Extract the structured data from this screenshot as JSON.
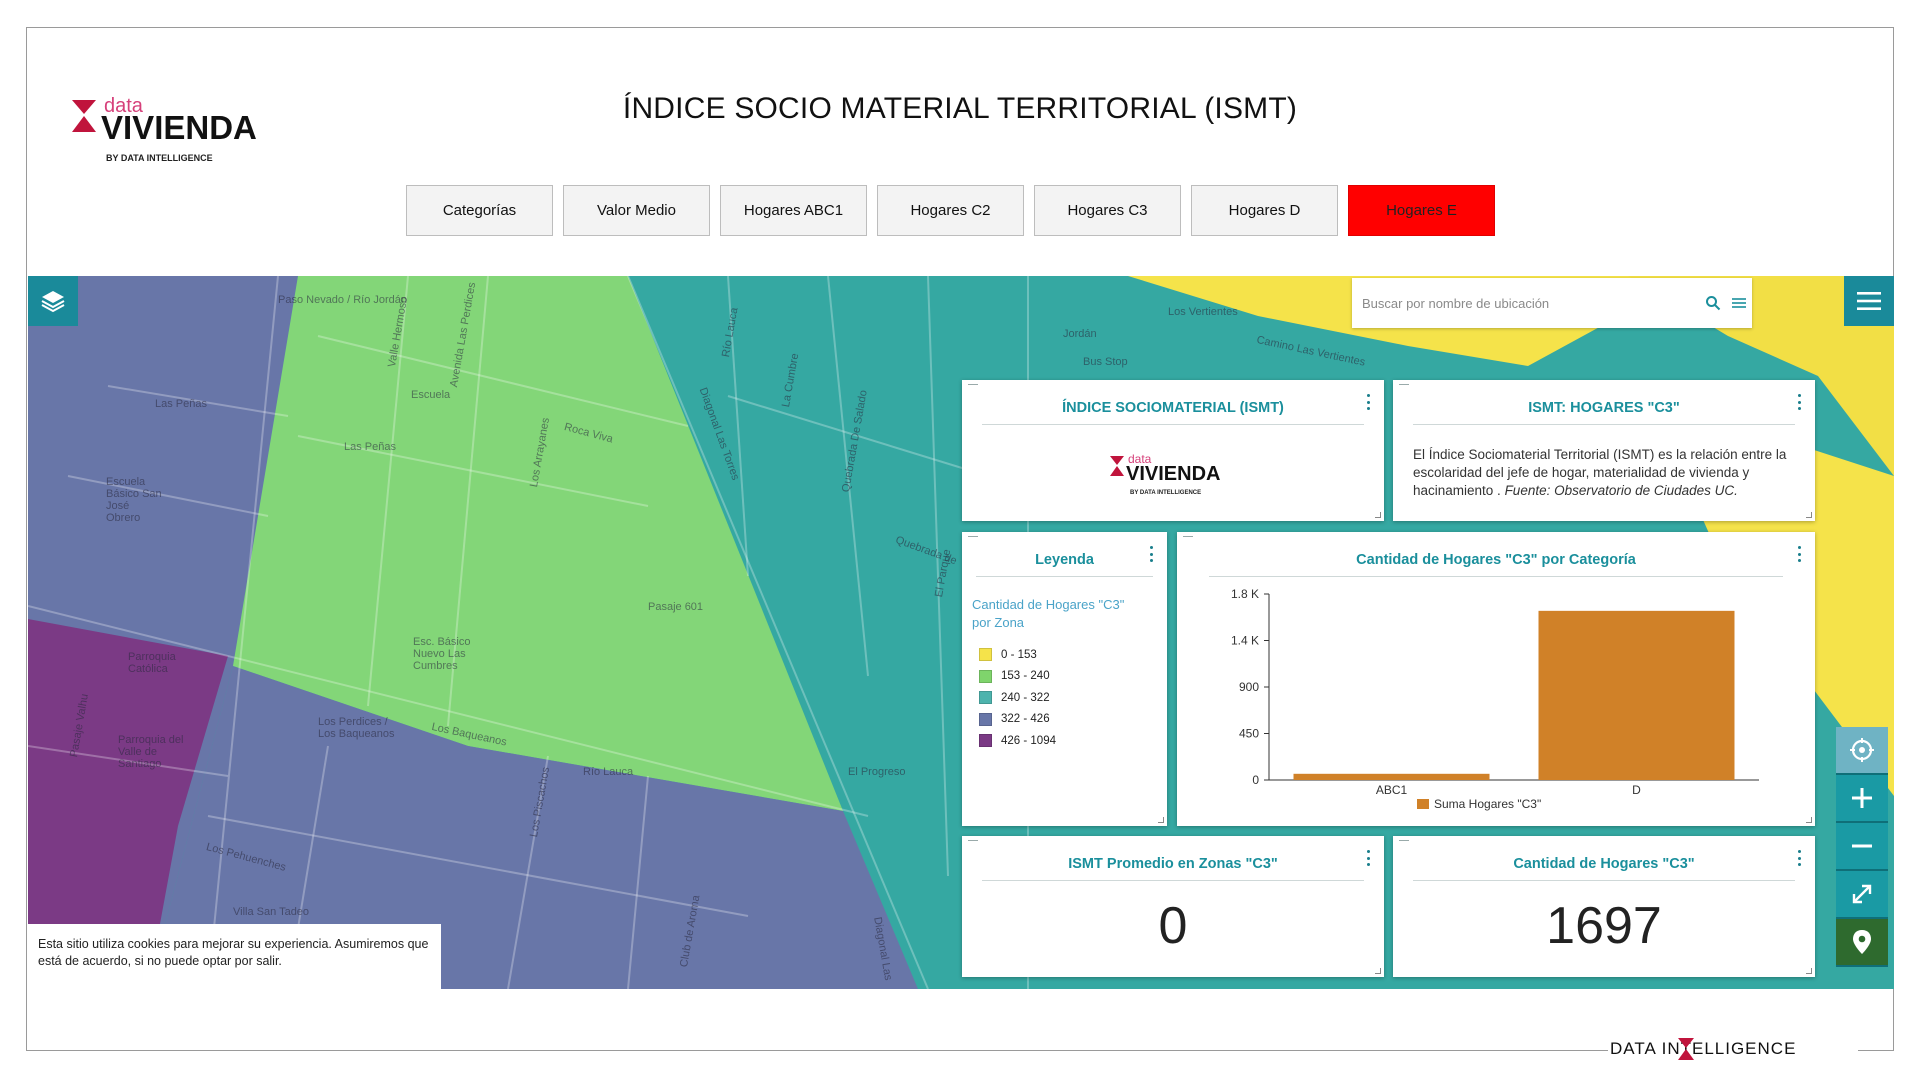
{
  "header": {
    "title": "ÍNDICE SOCIO MATERIAL TERRITORIAL (ISMT)",
    "logo": {
      "small": "data",
      "main": "VIVIENDA",
      "by": "BY DATA INTELLIGENCE"
    }
  },
  "tabs": [
    {
      "label": "Categorías",
      "active": false
    },
    {
      "label": "Valor Medio",
      "active": false
    },
    {
      "label": "Hogares ABC1",
      "active": false
    },
    {
      "label": "Hogares C2",
      "active": false
    },
    {
      "label": "Hogares C3",
      "active": false
    },
    {
      "label": "Hogares D",
      "active": false
    },
    {
      "label": "Hogares E",
      "active": true
    }
  ],
  "search": {
    "placeholder": "Buscar por nombre de ubicación"
  },
  "map_labels": [
    "Paso Nevado / Río Jordán",
    "Las Peñas",
    "Valle Hermoso",
    "Avenida Las Perdices",
    "Escuela",
    "Las Peñas",
    "Roca Viva",
    "Los Arrayanes",
    "Diagonal Las Torres",
    "Río Lauca",
    "La Cumbre",
    "Quebrada De Salado",
    "Jordán",
    "Los Vertientes",
    "Bus Stop",
    "Camino Las Vertientes",
    "Pasaje 601",
    "Escuela Básico San José Obrero",
    "Esc. Básico Nuevo Las Cumbres",
    "Parroquia Católica",
    "Pasaje Valhu",
    "Parroquia del Valle de Santiago",
    "Los Pehuenches",
    "Villa San Tadeo",
    "Los Perdices / Los Baqueanos",
    "Los Baqueanos",
    "Los Piscachos",
    "Río Lauca",
    "Club de Aroma",
    "El Progreso",
    "Quebrada de",
    "El Parque",
    "Diagonal Las"
  ],
  "cookie": {
    "text": "Esta sitio utiliza cookies para mejorar su experiencia. Asumiremos que está de acuerdo, si no puede optar por salir."
  },
  "widgets": {
    "ismt_logo": {
      "title": "ÍNDICE SOCIOMATERIAL (ISMT)"
    },
    "ismt_desc": {
      "title": "ISMT: HOGARES \"C3\"",
      "text": "El Índice Sociomaterial Territorial (ISMT) es la relación entre la escolaridad del jefe de hogar, materialidad de vivienda y hacinamiento . ",
      "source": "Fuente: Observatorio de Ciudades UC."
    },
    "legend": {
      "title": "Leyenda",
      "subtitle": "Cantidad de Hogares \"C3\" por Zona",
      "items": [
        {
          "label": "0 - 153",
          "color": "#f5e34a"
        },
        {
          "label": "153 - 240",
          "color": "#7fd46c"
        },
        {
          "label": "240 - 322",
          "color": "#4db3ad"
        },
        {
          "label": "322 - 426",
          "color": "#6876a8"
        },
        {
          "label": "426 - 1094",
          "color": "#7b3a85"
        }
      ]
    },
    "chart": {
      "title": "Cantidad de Hogares \"C3\" por Categoría"
    },
    "avg": {
      "title": "ISMT Promedio en Zonas \"C3\"",
      "value": "0"
    },
    "count": {
      "title": "Cantidad de Hogares \"C3\"",
      "value": "1697"
    }
  },
  "chart_data": {
    "type": "bar",
    "categories": [
      "ABC1",
      "D"
    ],
    "series": [
      {
        "name": "Suma Hogares \"C3\"",
        "values": [
          60,
          1637
        ],
        "color": "#d08128"
      }
    ],
    "y_ticks": [
      "0",
      "450",
      "900",
      "1.4 K",
      "1.8 K"
    ],
    "y_tick_values": [
      0,
      450,
      900,
      1350,
      1800
    ],
    "ylim": [
      0,
      1800
    ],
    "legend_position": "bottom"
  },
  "footer": {
    "brand": "DATA INTELLIGENCE"
  },
  "colors": {
    "accent": "#1a8f9c",
    "active_tab": "#ff0000",
    "bar": "#d08128"
  }
}
